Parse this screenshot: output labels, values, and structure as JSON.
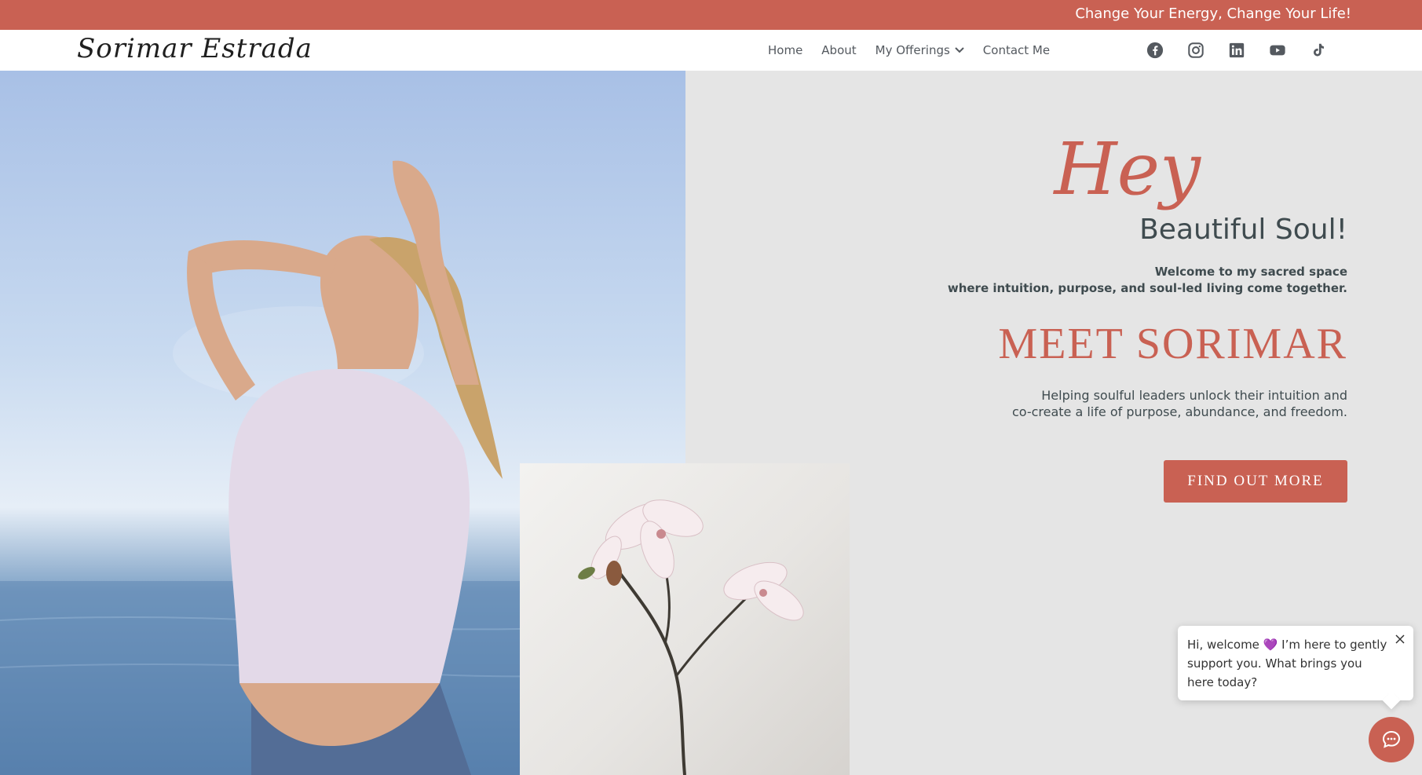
{
  "announcement": "Change Your Energy, Change Your Life!",
  "logo": "Sorimar Estrada",
  "nav": {
    "home": "Home",
    "about": "About",
    "offerings": "My Offerings",
    "contact": "Contact Me"
  },
  "social_icons": [
    "facebook-icon",
    "instagram-icon",
    "linkedin-icon",
    "youtube-icon",
    "tiktok-icon"
  ],
  "hero": {
    "greeting_script": "Hey",
    "greeting": "Beautiful Soul!",
    "welcome_line1": "Welcome to my sacred space",
    "welcome_line2": "where intuition, purpose, and soul-led living come together.",
    "headline": "MEET SORIMAR",
    "tagline_line1": "Helping soulful leaders unlock their intuition and",
    "tagline_line2": "co-create a life of purpose, abundance, and freedom.",
    "cta": "FIND OUT MORE"
  },
  "chat": {
    "message_part1": "Hi, welcome",
    "heart": "💜",
    "message_part2": "I’m here to gently support you. What brings you here today?"
  },
  "colors": {
    "accent": "#c96153",
    "text_dark": "#3f4b4f",
    "background": "#e5e5e5"
  }
}
